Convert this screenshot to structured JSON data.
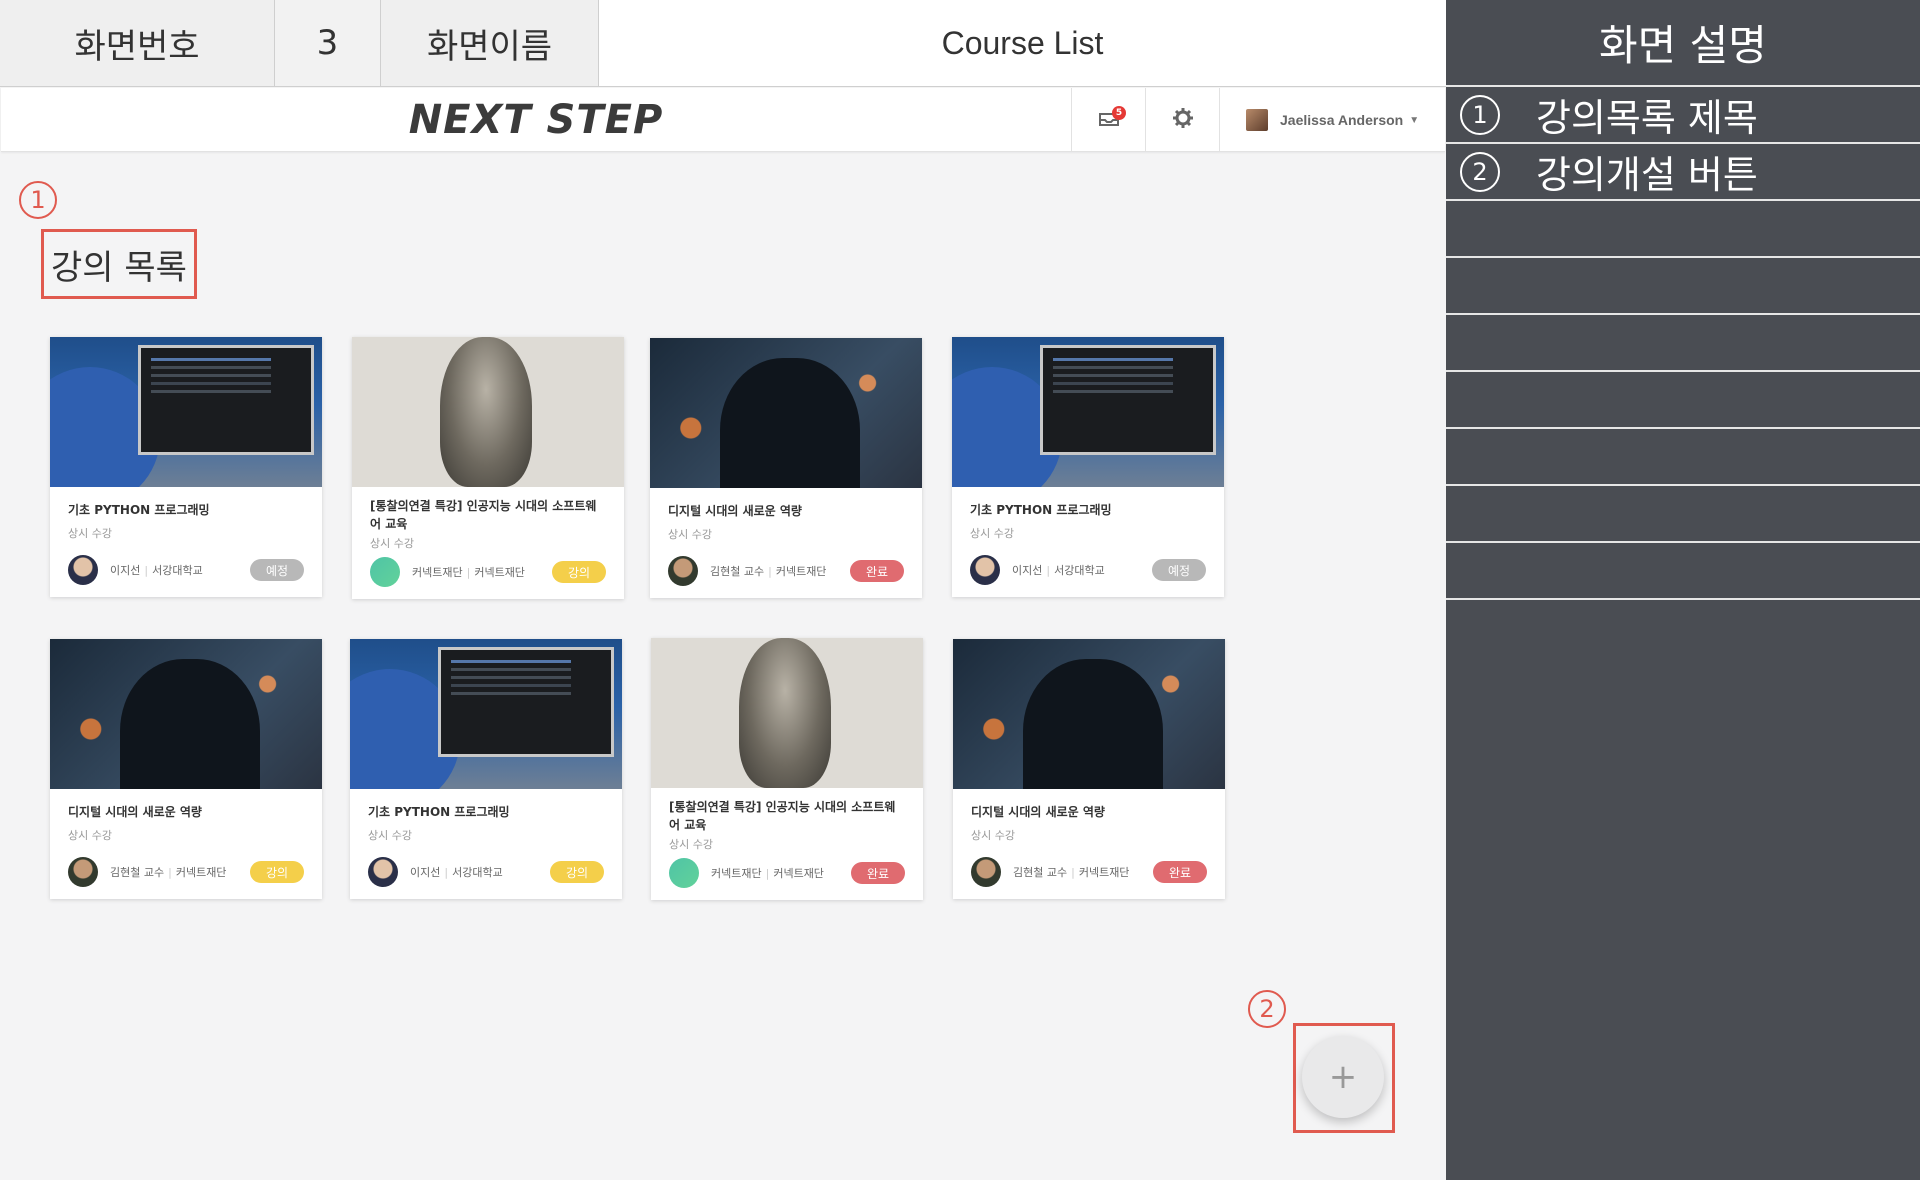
{
  "spec": {
    "screen_no_label": "화면번호",
    "screen_no": "3",
    "screen_name_label": "화면이름",
    "screen_name": "Course List"
  },
  "description_panel": {
    "title": "화면 설명",
    "items": [
      {
        "num": "1",
        "text": "강의목록 제목"
      },
      {
        "num": "2",
        "text": "강의개설 버튼"
      }
    ]
  },
  "navbar": {
    "brand": "NEXT STEP",
    "notification_count": "5",
    "user_name": "Jaelissa Anderson"
  },
  "markers": {
    "one": "1",
    "two": "2"
  },
  "page_title": "강의 목록",
  "fab_label": "+",
  "courses": [
    {
      "title": "기초 PYTHON 프로그래밍",
      "sub": "상시 수강",
      "instructor": "이지선",
      "org": "서강대학교",
      "status": "예정"
    },
    {
      "title": "[통찰의연결 특강] 인공지능 시대의 소프트웨어 교육",
      "sub": "상시 수강",
      "instructor": "커넥트재단",
      "org": "커넥트재단",
      "status": "강의"
    },
    {
      "title": "디지털 시대의 새로운 역량",
      "sub": "상시 수강",
      "instructor": "김현철 교수",
      "org": "커넥트재단",
      "status": "완료"
    },
    {
      "title": "기초 PYTHON 프로그래밍",
      "sub": "상시 수강",
      "instructor": "이지선",
      "org": "서강대학교",
      "status": "예정"
    },
    {
      "title": "디지털 시대의 새로운 역량",
      "sub": "상시 수강",
      "instructor": "김현철 교수",
      "org": "커넥트재단",
      "status": "강의"
    },
    {
      "title": "기초 PYTHON 프로그래밍",
      "sub": "상시 수강",
      "instructor": "이지선",
      "org": "서강대학교",
      "status": "강의"
    },
    {
      "title": "[통찰의연결 특강] 인공지능 시대의 소프트웨어 교육",
      "sub": "상시 수강",
      "instructor": "커넥트재단",
      "org": "커넥트재단",
      "status": "완료"
    },
    {
      "title": "디지털 시대의 새로운 역량",
      "sub": "상시 수강",
      "instructor": "김현철 교수",
      "org": "커넥트재단",
      "status": "완료"
    }
  ],
  "colors": {
    "accent_red": "#e05a4f",
    "panel_bg": "#4a4d53",
    "pill_gray": "#b8b8b8",
    "pill_yellow": "#f4cf4a",
    "pill_red": "#e06b70"
  }
}
